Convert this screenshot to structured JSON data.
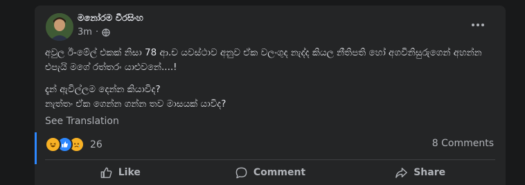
{
  "post": {
    "author": "මනෝරම වීරසිංහ",
    "time": "3m",
    "privacy_icon": "globe-icon",
    "text_lines": [
      "අවුල ඊ-මේල් එකක් නිසා 78 ආ.ච යවස්ථාව අනුව ඒක වලංගුද නැද්ද කියල නීතිපති හෝ අගවිනිසුරුගෙන් අහන්න",
      "එපැයි මගේ රත්තරං යාළුවනේ....!",
      "දැන් ඇවිල්ලම දෙන්න කියාවිද?",
      "නැත්තං ඒක ගෙන්න ගන්න තව මාසයක් යාවිද?"
    ],
    "see_translation": "See Translation"
  },
  "reactions": {
    "icons": [
      "haha-icon",
      "like-icon",
      "sad-icon"
    ],
    "count": "26",
    "comments": "8 Comments"
  },
  "actions": {
    "like": "Like",
    "comment": "Comment",
    "share": "Share"
  },
  "colors": {
    "background": "#18191a",
    "card": "#242526",
    "text_primary": "#e4e6eb",
    "text_secondary": "#b0b3b8",
    "accent": "#2d88ff"
  }
}
